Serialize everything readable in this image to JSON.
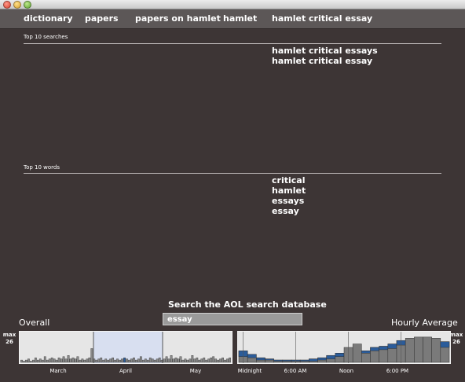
{
  "nav": {
    "items": [
      "dictionary",
      "papers",
      "papers on hamlet",
      "hamlet",
      "hamlet critical essay"
    ]
  },
  "top_searches": {
    "label": "Top 10 searches",
    "items": [
      "hamlet critical essays",
      "hamlet critical essay"
    ]
  },
  "top_words": {
    "label": "Top 10 words",
    "items": [
      "critical",
      "hamlet",
      "essays",
      "essay"
    ]
  },
  "search": {
    "title": "Search the AOL search database",
    "value": "essay"
  },
  "chart_data": [
    {
      "type": "bar",
      "title": "Overall",
      "max_label": "max",
      "max_value": "26",
      "ticks": [
        "March",
        "April",
        "May"
      ],
      "colors": {
        "background": "#e6e6e6",
        "highlight": "#d8dff0",
        "bar": "#8a8a8a",
        "accent": "#2b5c9a"
      },
      "values": [
        2,
        1,
        2,
        3,
        1,
        2,
        4,
        2,
        3,
        2,
        5,
        2,
        3,
        4,
        3,
        2,
        4,
        3,
        5,
        3,
        6,
        3,
        4,
        3,
        5,
        2,
        3,
        2,
        3,
        4,
        12,
        3,
        2,
        3,
        4,
        2,
        3,
        2,
        3,
        4,
        2,
        3,
        2,
        3,
        4,
        3,
        2,
        3,
        4,
        2,
        3,
        5,
        2,
        3,
        2,
        4,
        3,
        2,
        3,
        4,
        2,
        3,
        5,
        3,
        6,
        3,
        4,
        3,
        5,
        2,
        3,
        2,
        3,
        6,
        3,
        4,
        2,
        3,
        4,
        2,
        3,
        4,
        5,
        3,
        2,
        3,
        4,
        2,
        3,
        4
      ],
      "accents": [
        0,
        0,
        0,
        0,
        0,
        0,
        0,
        0,
        0,
        0,
        0,
        0,
        0,
        0,
        0,
        0,
        0,
        0,
        0,
        0,
        0,
        0,
        0,
        0,
        0,
        0,
        0,
        0,
        0,
        0,
        0,
        0,
        0,
        0,
        0,
        0,
        0,
        0,
        0,
        0,
        0,
        0,
        0,
        0,
        1,
        0,
        0,
        0,
        0,
        0,
        0,
        0,
        0,
        0,
        0,
        0,
        0,
        0,
        0,
        0,
        0,
        0,
        0,
        0,
        0,
        0,
        0,
        0,
        0,
        0,
        0,
        0,
        0,
        0,
        0,
        0,
        0,
        0,
        0,
        0,
        0,
        0,
        0,
        0,
        0,
        0,
        0,
        0,
        0,
        0
      ],
      "ylim": [
        0,
        26
      ]
    },
    {
      "type": "bar",
      "title": "Hourly Average",
      "max_label": "max",
      "max_value": "26",
      "ticks": [
        "Midnight",
        "6:00 AM",
        "Noon",
        "6:00 PM"
      ],
      "colors": {
        "background": "#e6e6e6",
        "bar": "#7a7a7a",
        "accent": "#2b5c9a"
      },
      "values": [
        10,
        7,
        4,
        3,
        2,
        2,
        2,
        2,
        3,
        4,
        6,
        8,
        13,
        16,
        10,
        13,
        14,
        16,
        19,
        21,
        22,
        22,
        21,
        18
      ],
      "accents": [
        5,
        3,
        2,
        1,
        1,
        1,
        1,
        1,
        2,
        2,
        3,
        3,
        0,
        0,
        2,
        3,
        3,
        4,
        4,
        0,
        0,
        0,
        0,
        5
      ],
      "ylim": [
        0,
        26
      ]
    }
  ]
}
